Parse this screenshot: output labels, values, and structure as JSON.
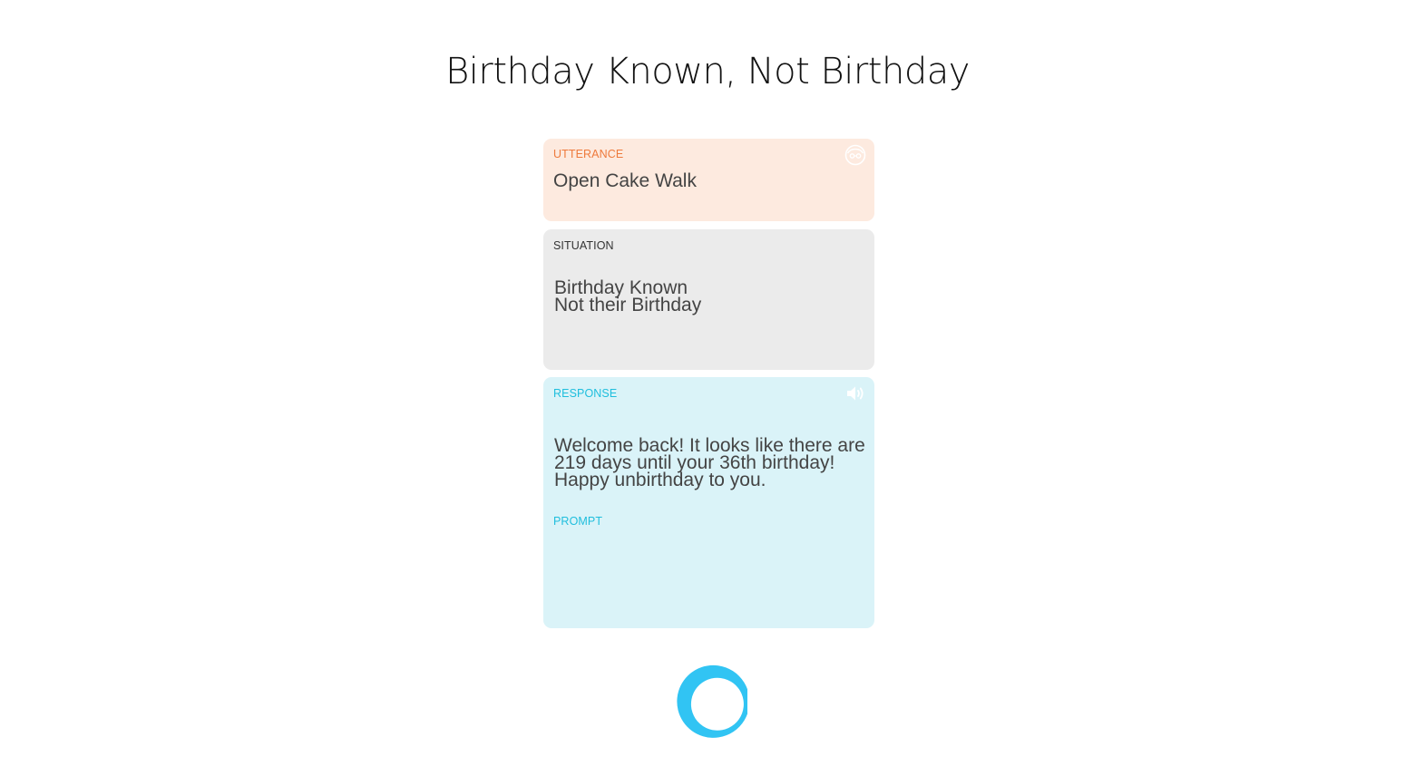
{
  "page": {
    "title": "Birthday Known, Not Birthday"
  },
  "utterance": {
    "label": "UTTERANCE",
    "text": "Open Cake Walk",
    "icon": "face-icon",
    "color": "#ee7a3c",
    "background": "#fdeadf"
  },
  "situation": {
    "label": "SITUATION",
    "text": "Birthday Known\nNot their Birthday",
    "background": "#ebebeb"
  },
  "response": {
    "label": "RESPONSE",
    "text": "Welcome back! It looks like there are 219 days until your 36th birthday! Happy unbirthday to you.",
    "prompt_label": "PROMPT",
    "prompt_text": "",
    "icon": "speaker-icon",
    "color": "#1fbedd",
    "background": "#daf3f8"
  },
  "footer": {
    "logo": "alexa-logo-icon",
    "logo_color": "#31c4f3"
  }
}
